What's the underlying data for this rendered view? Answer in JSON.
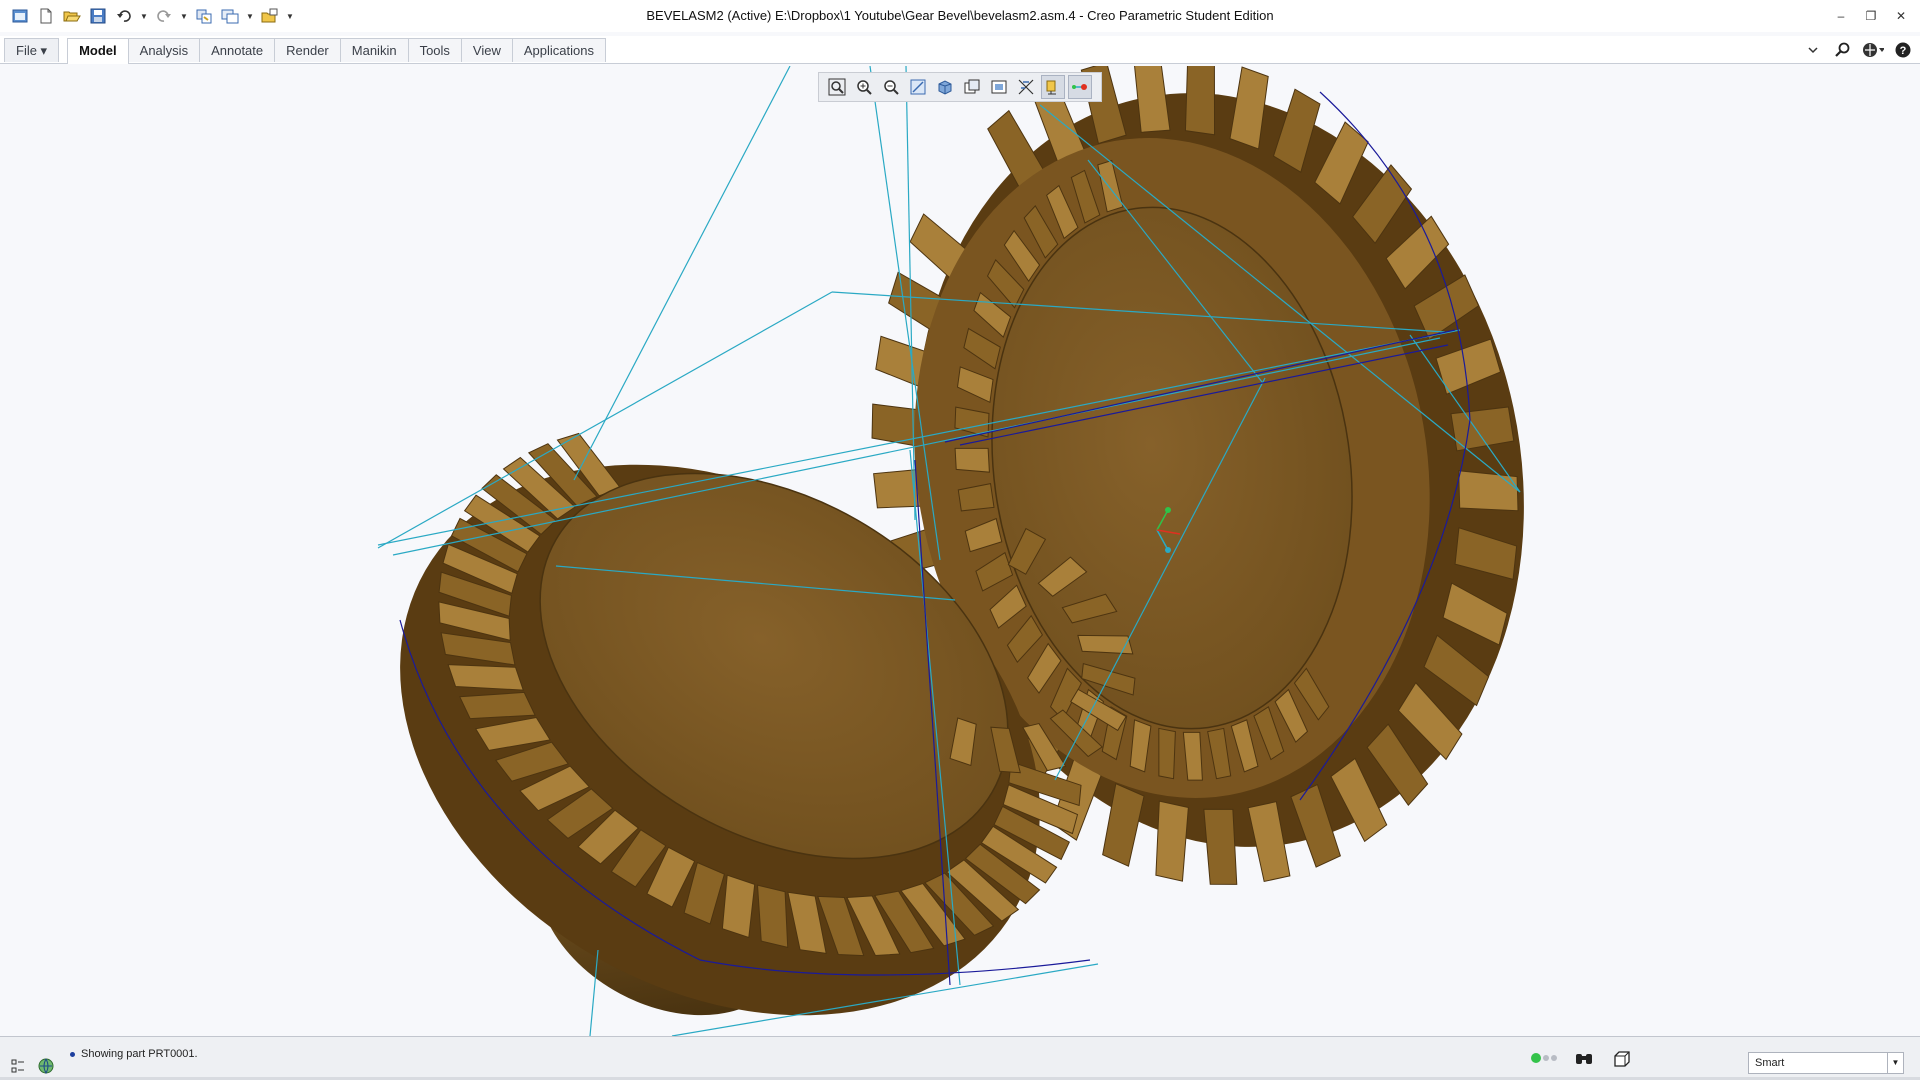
{
  "window": {
    "title": "BEVELASM2 (Active) E:\\Dropbox\\1 Youtube\\Gear Bevel\\bevelasm2.asm.4 - Creo Parametric Student Edition",
    "minimize_glyph": "–",
    "restore_glyph": "❐",
    "close_glyph": "✕"
  },
  "quick_access": {
    "icons": [
      "app-icon",
      "new-icon",
      "open-icon",
      "save-icon",
      "undo-icon",
      "redo-icon",
      "regenerate-icon",
      "windows-icon",
      "close-window-icon",
      "customize-icon"
    ]
  },
  "ribbon": {
    "file_label": "File ▾",
    "tabs": [
      {
        "label": "Model",
        "active": true
      },
      {
        "label": "Analysis"
      },
      {
        "label": "Annotate"
      },
      {
        "label": "Render"
      },
      {
        "label": "Manikin"
      },
      {
        "label": "Tools"
      },
      {
        "label": "View"
      },
      {
        "label": "Applications"
      }
    ],
    "right_icons": [
      "minimize-ribbon-icon",
      "search-icon",
      "community-icon",
      "help-icon"
    ]
  },
  "graphics_toolbar": {
    "icons": [
      "refit-icon",
      "zoom-in-icon",
      "zoom-out-icon",
      "repaint-icon",
      "display-style-icon",
      "saved-orientations-icon",
      "view-manager-icon",
      "perspective-icon",
      "datum-display-icon",
      "spin-center-icon"
    ],
    "selected": [
      "datum-display-icon",
      "spin-center-icon"
    ]
  },
  "status": {
    "message": "Showing part PRT0001.",
    "selection_filter": "Smart"
  },
  "colors": {
    "gear_base": "#8a6426",
    "gear_light": "#a9803a",
    "gear_dark": "#4d3410",
    "datum_lines": "#2aa9c4",
    "edge_blue": "#1a1a9a",
    "background": "#f7f8fb"
  }
}
